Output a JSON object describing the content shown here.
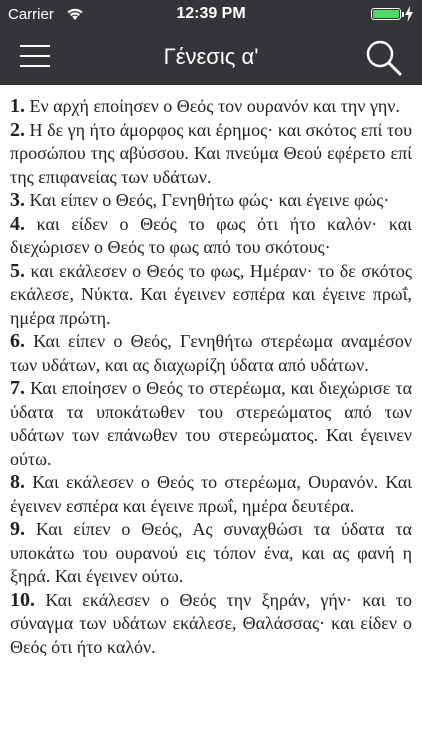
{
  "status_bar": {
    "carrier": "Carrier",
    "time": "12:39 PM",
    "battery_percent": 100,
    "battery_color": "#4cd964"
  },
  "nav": {
    "title": "Γένεσις α'",
    "menu_icon": "hamburger-menu-icon",
    "search_icon": "magnifier-search-icon",
    "background": "#333538"
  },
  "verses": [
    {
      "num": "1.",
      "text": "Εν αρχή εποίησεν ο Θεός τον ουρανόν και την γην."
    },
    {
      "num": "2.",
      "text": "Η δε γη ήτο άμορφος και έρημος· και σκότος επί του προσώπου της αβύσσου. Και πνεύμα Θεού εφέρετο επί της επιφανείας των υδάτων."
    },
    {
      "num": "3.",
      "text": "Και είπεν ο Θεός, Γενηθήτω φώς· και έγεινε φώς·"
    },
    {
      "num": "4.",
      "text": "και είδεν ο Θεός το φως ότι ήτο καλόν· και διεχώρισεν ο Θεός το φως από του σκότους·"
    },
    {
      "num": "5.",
      "text": "και εκάλεσεν ο Θεός το φως, Ημέραν· το δε σκότος εκάλεσε, Νύκτα. Και έγεινεν εσπέρα και έγεινε πρωΐ, ημέρα πρώτη."
    },
    {
      "num": "6.",
      "text": "Και είπεν ο Θεός, Γενηθήτω στερέωμα αναμέσον των υδάτων, και ας διαχωρίζη ύδατα από υδάτων."
    },
    {
      "num": "7.",
      "text": "Και εποίησεν ο Θεός το στερέωμα, και διεχώρισε τα ύδατα τα υποκάτωθεν του στερεώματος από των υδάτων των επάνωθεν του στερεώματος. Και έγεινεν ούτω."
    },
    {
      "num": "8.",
      "text": "Και εκάλεσεν ο Θεός το στερέωμα, Ουρανόν. Και έγεινεν εσπέρα και έγεινε πρωΐ, ημέρα δευτέρα."
    },
    {
      "num": "9.",
      "text": "Και είπεν ο Θεός, Ας συναχθώσι τα ύδατα τα υποκάτω του ουρανού εις τόπον ένα, και ας φανή η ξηρά. Και έγεινεν ούτω."
    },
    {
      "num": "10.",
      "text": "Και εκάλεσεν ο Θεός την ξηράν, γήν· και το σύναγμα των υδάτων εκάλεσε, Θαλάσσας· και είδεν ο Θεός ότι ήτο καλόν."
    }
  ]
}
